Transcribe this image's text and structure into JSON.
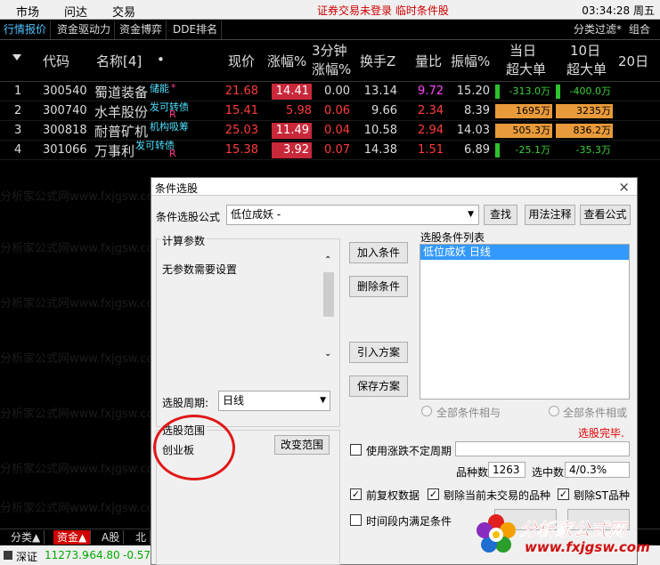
{
  "menubar": {
    "items": [
      "市场",
      "问达",
      "交易"
    ],
    "warning": "证券交易未登录  临时条件股",
    "time": "03:34:28 周五"
  },
  "tabs": {
    "items": [
      "行情报价",
      "资金驱动力",
      "资金博弈",
      "DDE排名"
    ],
    "right": [
      "分类过滤*",
      "组合"
    ]
  },
  "columns": {
    "code": "代码",
    "name": "名称[4]",
    "dot": "•",
    "price": "现价",
    "change": "涨幅%",
    "min3_a": "3分钟",
    "min3_b": "涨幅%",
    "turnover": "换手Z",
    "volratio": "量比",
    "amplitude": "振幅%",
    "today_a": "当日",
    "today_b": "超大单",
    "tenday_a": "10日",
    "tenday_b": "超大单",
    "day20": "20日"
  },
  "rows": [
    {
      "idx": "1",
      "code": "300540",
      "name": "蜀道装备",
      "tag": "储能",
      "tag2": "*",
      "price": "21.68",
      "change": "14.41",
      "min3": "0.00",
      "turnover": "13.14",
      "volratio": "9.72",
      "amplitude": "15.20",
      "today": "-313.0万",
      "tenday": "-400.0万"
    },
    {
      "idx": "2",
      "code": "300740",
      "name": "水羊股份",
      "tag": "发可转债",
      "tag2": "R",
      "price": "15.41",
      "change": "5.98",
      "min3": "0.06",
      "turnover": "9.66",
      "volratio": "2.34",
      "amplitude": "8.39",
      "today": "1695万",
      "tenday": "3235万"
    },
    {
      "idx": "3",
      "code": "300818",
      "name": "耐普矿机",
      "tag": "机构吸筹",
      "tag2": "",
      "price": "25.03",
      "change": "11.49",
      "min3": "0.04",
      "turnover": "10.58",
      "volratio": "2.94",
      "amplitude": "14.03",
      "today": "505.3万",
      "tenday": "836.2万"
    },
    {
      "idx": "4",
      "code": "301066",
      "name": "万事利",
      "tag": "发可转债",
      "tag2": "R",
      "price": "15.38",
      "change": "3.92",
      "min3": "0.07",
      "turnover": "14.38",
      "volratio": "1.51",
      "amplitude": "6.89",
      "today": "-25.1万",
      "tenday": "-35.3万"
    }
  ],
  "watermark": "分析家公式网www.fxjgsw.com",
  "bottom_tabs": [
    "分类▲",
    "资金▲",
    "A股",
    "北"
  ],
  "status": {
    "market": "深证",
    "index": "11273.9",
    "change": "-64.80",
    "pct": "-0.57%"
  },
  "dialog": {
    "title": "条件选股",
    "close": "×",
    "formula_label": "条件选股公式",
    "formula_value": "低位成妖      -",
    "find": "查找",
    "usage": "用法注释",
    "view": "查看公式",
    "params_label": "计算参数",
    "params_text": "无参数需要设置",
    "add": "加入条件",
    "delete": "删除条件",
    "import": "引入方案",
    "save": "保存方案",
    "list_label": "选股条件列表",
    "list_items": [
      "低位成妖  日线"
    ],
    "period_label": "选股周期:",
    "period_value": "日线",
    "radio_and": "全部条件相与",
    "radio_or": "全部条件相或",
    "done": "选股完毕.",
    "range_label": "选股范围",
    "range_value": "创业板",
    "change_range": "改变范围",
    "use_period": "使用涨跌不定周期",
    "count_label": "品种数",
    "count_value": "1263",
    "hit_label": "选中数",
    "hit_value": "4/0.3%",
    "cb_fq": "前复权数据",
    "cb_exclude_untraded": "剔除当前未交易的品种",
    "cb_exclude_st": "剔除ST品种",
    "cb_period_all": "时间段内满足条件"
  },
  "logo": {
    "cn": "分析家公式网",
    "url": "www.fxjgsw.com"
  }
}
